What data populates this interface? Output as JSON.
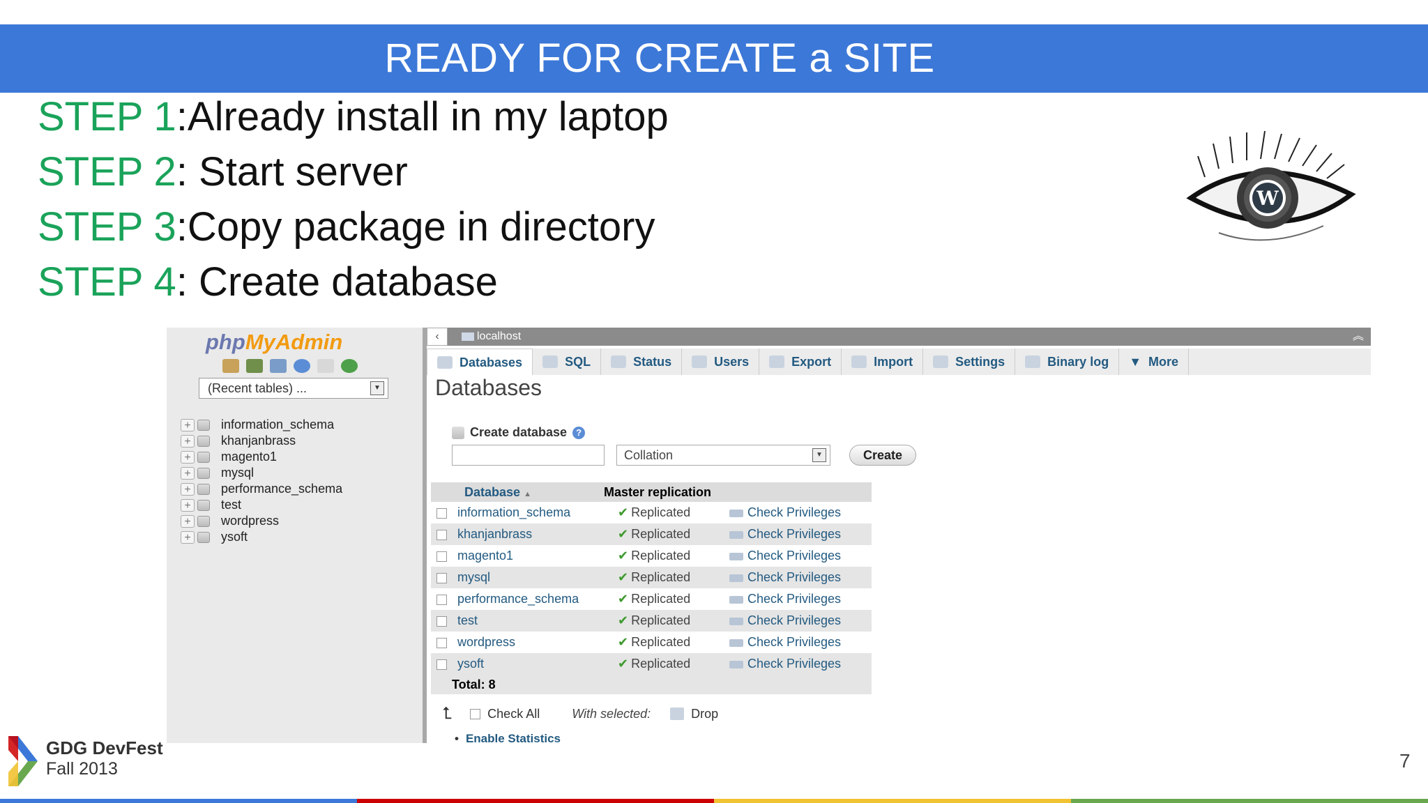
{
  "slide": {
    "title": "READY FOR CREATE a SITE",
    "page_number": "7",
    "steps": [
      {
        "label": "STEP 1",
        "text": ":Already install in my laptop"
      },
      {
        "label": "STEP 2",
        "text": ": Start server"
      },
      {
        "label": "STEP 3",
        "text": ":Copy package in directory"
      },
      {
        "label": "STEP 4",
        "text": ": Create database"
      }
    ],
    "footer": {
      "brand": "GDG DevFest",
      "edition": "Fall 2013"
    },
    "bottom_bar_colors": [
      "#3c78d8",
      "#cc0000",
      "#f1c232",
      "#6aa84f"
    ]
  },
  "phpmyadmin": {
    "logo": {
      "php": "php",
      "myadmin": "MyAdmin"
    },
    "recent_tables": "(Recent tables) ...",
    "tree": [
      "information_schema",
      "khanjanbrass",
      "magento1",
      "mysql",
      "performance_schema",
      "test",
      "wordpress",
      "ysoft"
    ],
    "server": "localhost",
    "tabs": [
      "Databases",
      "SQL",
      "Status",
      "Users",
      "Export",
      "Import",
      "Settings",
      "Binary log",
      "More"
    ],
    "heading": "Databases",
    "create_database_label": "Create database",
    "collation_placeholder": "Collation",
    "create_button": "Create",
    "table": {
      "headers": {
        "database": "Database",
        "replication": "Master replication"
      },
      "rows": [
        {
          "name": "information_schema",
          "status": "Replicated",
          "action": "Check Privileges"
        },
        {
          "name": "khanjanbrass",
          "status": "Replicated",
          "action": "Check Privileges"
        },
        {
          "name": "magento1",
          "status": "Replicated",
          "action": "Check Privileges"
        },
        {
          "name": "mysql",
          "status": "Replicated",
          "action": "Check Privileges"
        },
        {
          "name": "performance_schema",
          "status": "Replicated",
          "action": "Check Privileges"
        },
        {
          "name": "test",
          "status": "Replicated",
          "action": "Check Privileges"
        },
        {
          "name": "wordpress",
          "status": "Replicated",
          "action": "Check Privileges"
        },
        {
          "name": "ysoft",
          "status": "Replicated",
          "action": "Check Privileges"
        }
      ],
      "total": "Total: 8"
    },
    "check_all": "Check All",
    "with_selected": "With selected:",
    "drop": "Drop",
    "enable_statistics": "Enable Statistics"
  }
}
